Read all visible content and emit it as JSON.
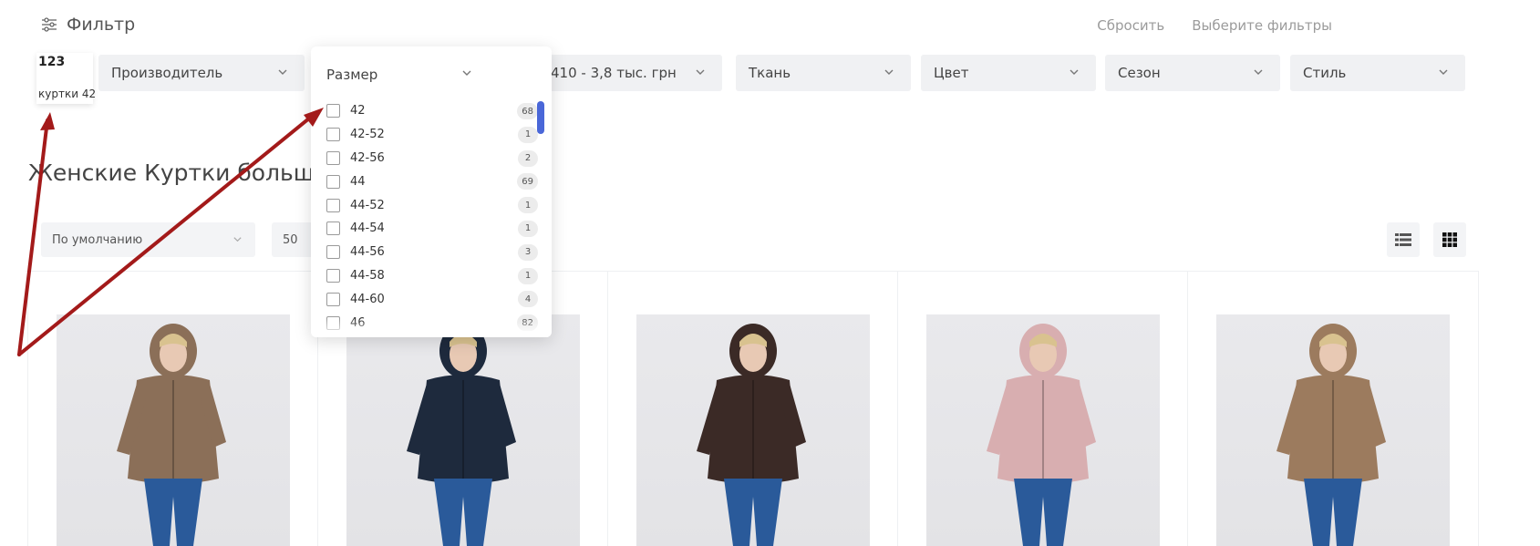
{
  "header": {
    "filter_title": "Фильтр",
    "reset_label": "Сбросить",
    "choose_filters_label": "Выберите фильтры"
  },
  "tooltip": {
    "number": "123",
    "text": "куртки 42"
  },
  "filters": [
    {
      "label": "Производитель"
    },
    {
      "label": "410 - 3,8 тыс. грн"
    },
    {
      "label": "Ткань"
    },
    {
      "label": "Цвет"
    },
    {
      "label": "Сезон"
    },
    {
      "label": "Стиль"
    }
  ],
  "size_dropdown": {
    "title": "Размер",
    "options": [
      {
        "label": "42",
        "count": "68"
      },
      {
        "label": "42-52",
        "count": "1"
      },
      {
        "label": "42-56",
        "count": "2"
      },
      {
        "label": "44",
        "count": "69"
      },
      {
        "label": "44-52",
        "count": "1"
      },
      {
        "label": "44-54",
        "count": "1"
      },
      {
        "label": "44-56",
        "count": "3"
      },
      {
        "label": "44-58",
        "count": "1"
      },
      {
        "label": "44-60",
        "count": "4"
      },
      {
        "label": "46",
        "count": "82"
      }
    ]
  },
  "page_title": "Женские Куртки больших",
  "sort": {
    "selected": "По умолчанию",
    "per_page": "50"
  },
  "products": [
    {
      "color": "#8b6f58"
    },
    {
      "color": "#1e2a3d"
    },
    {
      "color": "#3b2a26"
    },
    {
      "color": "#d8aeb0"
    },
    {
      "color": "#9c7b5e"
    }
  ],
  "colors": {
    "accent_scrollbar": "#4a67d8",
    "arrow": "#a31a1a"
  }
}
